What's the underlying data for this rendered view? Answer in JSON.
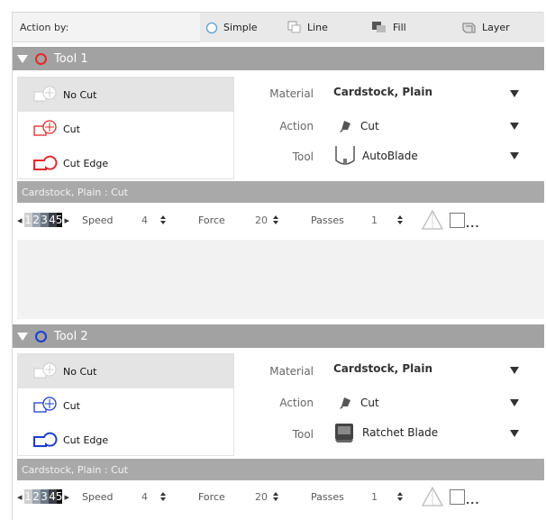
{
  "action_bar": {
    "label": "Action by:",
    "options": [
      {
        "label": "Simple",
        "icon": "circle-outline-icon",
        "selected": true
      },
      {
        "label": "Line",
        "icon": "line-icon"
      },
      {
        "label": "Fill",
        "icon": "fill-icon"
      },
      {
        "label": "Layer",
        "icon": "layer-icon"
      }
    ]
  },
  "tools": [
    {
      "title": "Tool 1",
      "color": "#e02a2a",
      "cut_options": [
        {
          "label": "No Cut",
          "icon": "no-cut-icon",
          "selected": true
        },
        {
          "label": "Cut",
          "icon": "cut-icon"
        },
        {
          "label": "Cut Edge",
          "icon": "cut-edge-icon"
        }
      ],
      "properties": {
        "material_label": "Material",
        "material_value": "Cardstock, Plain",
        "action_label": "Action",
        "action_value": "Cut",
        "tool_label": "Tool",
        "tool_value": "AutoBlade"
      },
      "summary": "Cardstock, Plain : Cut",
      "settings": {
        "blade_digits": [
          "1",
          "2",
          "3",
          "4",
          "5"
        ],
        "speed_label": "Speed",
        "speed_value": "4",
        "force_label": "Force",
        "force_value": "20",
        "passes_label": "Passes",
        "passes_value": "1",
        "more": "..."
      }
    },
    {
      "title": "Tool 2",
      "color": "#1a3ecf",
      "cut_options": [
        {
          "label": "No Cut",
          "icon": "no-cut-icon",
          "selected": true
        },
        {
          "label": "Cut",
          "icon": "cut-icon"
        },
        {
          "label": "Cut Edge",
          "icon": "cut-edge-icon"
        }
      ],
      "properties": {
        "material_label": "Material",
        "material_value": "Cardstock, Plain",
        "action_label": "Action",
        "action_value": "Cut",
        "tool_label": "Tool",
        "tool_value": "Ratchet Blade"
      },
      "summary": "Cardstock, Plain : Cut",
      "settings": {
        "blade_digits": [
          "1",
          "2",
          "3",
          "4",
          "5"
        ],
        "speed_label": "Speed",
        "speed_value": "4",
        "force_label": "Force",
        "force_value": "20",
        "passes_label": "Passes",
        "passes_value": "1",
        "more": "..."
      }
    }
  ]
}
